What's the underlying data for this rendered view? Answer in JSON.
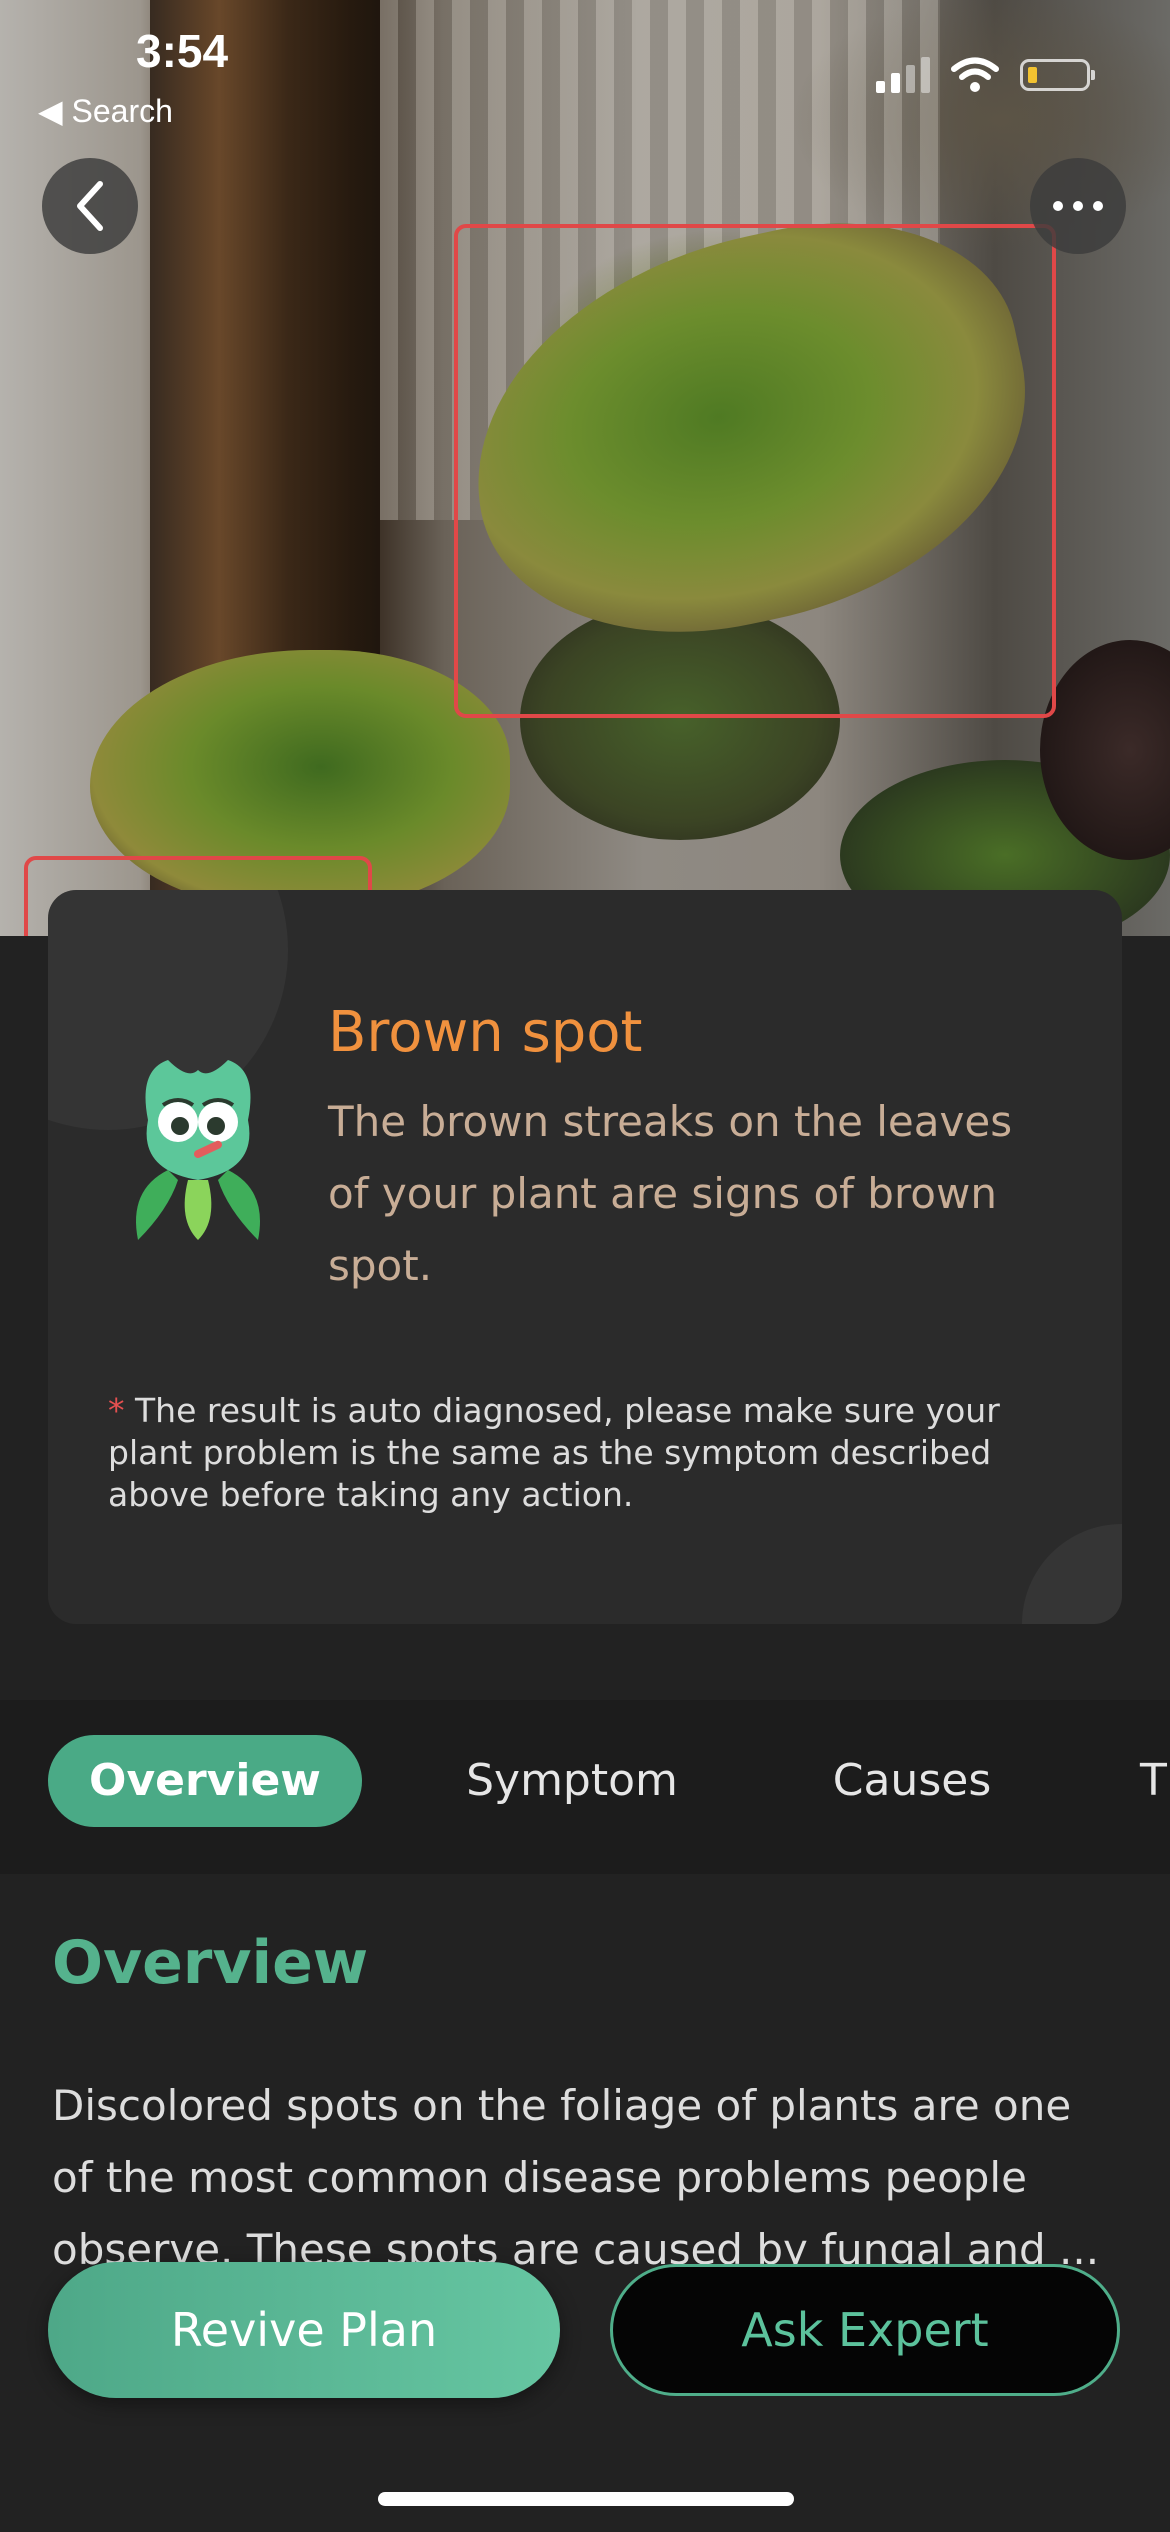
{
  "status_bar": {
    "time": "3:54",
    "back_label": "◀ Search"
  },
  "header": {
    "back_icon": "chevron-left-icon",
    "more_icon": "more-horizontal-icon"
  },
  "diagnosis": {
    "title": "Brown spot",
    "description": "The brown streaks on the leaves of your plant are signs of brown spot.",
    "note_star": "*",
    "note": " The result is auto diagnosed, please make sure your plant problem is the same as the symptom described above before taking any action.",
    "mascot_icon": "sick-plant-mascot-icon"
  },
  "tabs": [
    {
      "label": "Overview",
      "active": true
    },
    {
      "label": "Symptom",
      "active": false
    },
    {
      "label": "Causes",
      "active": false
    },
    {
      "label": "T",
      "active": false
    }
  ],
  "overview": {
    "title": "Overview",
    "text": "Discolored spots on the foliage of plants are one of the most common disease problems people observe. These spots are caused by fungal and ... to a fungal pathogen."
  },
  "actions": {
    "revive_label": "Revive Plan",
    "ask_label": "Ask Expert"
  },
  "colors": {
    "accent_green": "#4aaa86",
    "title_orange": "#f0913e",
    "bbox_red": "#e04848"
  }
}
